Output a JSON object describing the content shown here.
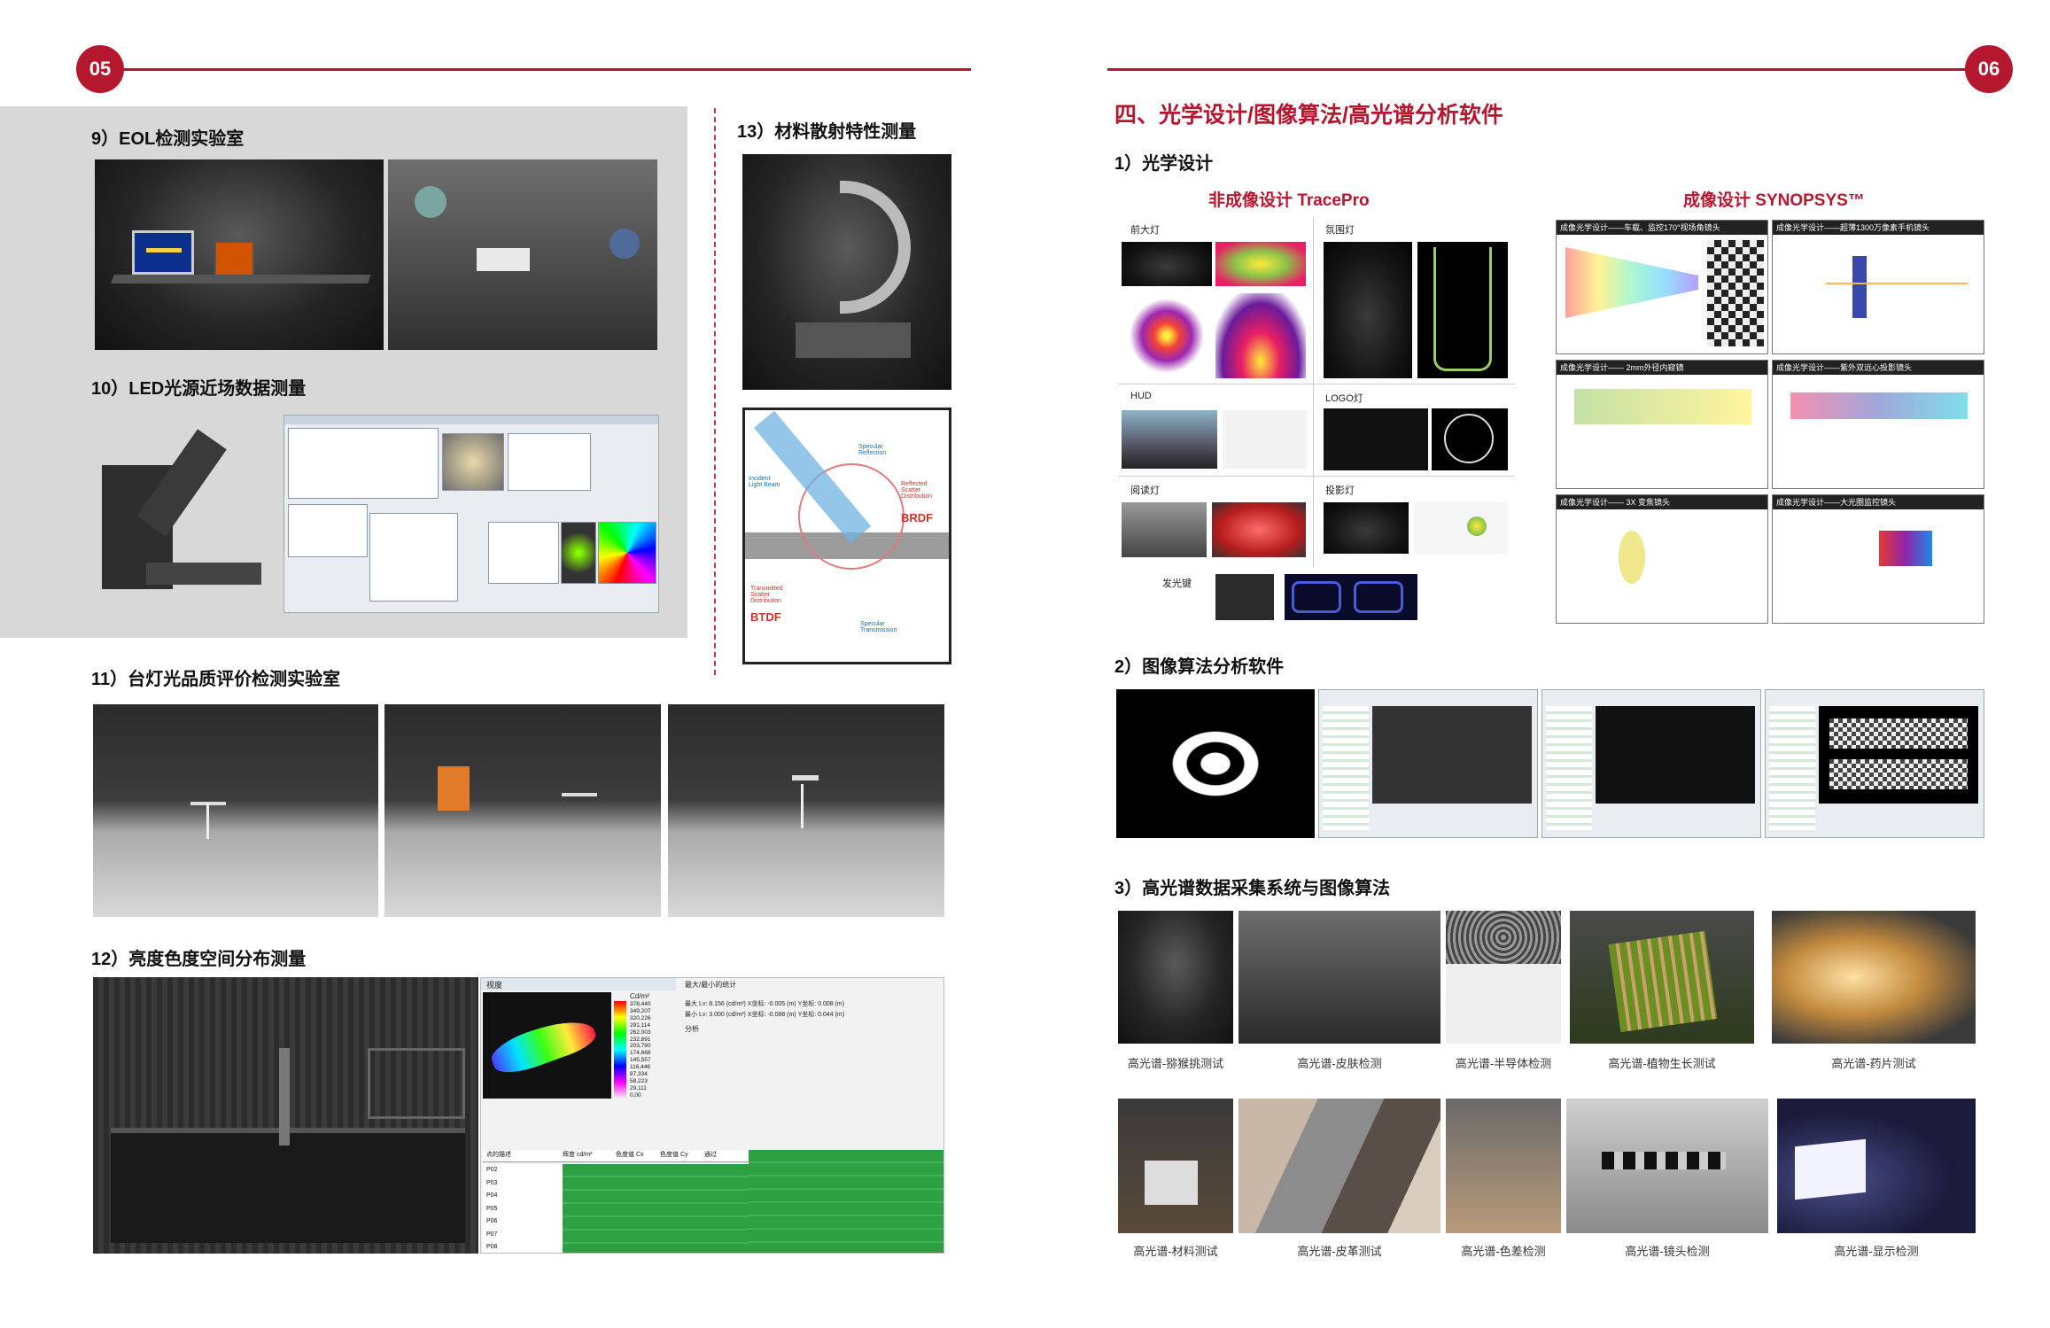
{
  "pages": {
    "left_number": "05",
    "right_number": "06"
  },
  "left": {
    "s9": {
      "title": "9）EOL检测实验室"
    },
    "s10": {
      "title": "10）LED光源近场数据测量"
    },
    "s11": {
      "title": "11）台灯光品质评价检测实验室"
    },
    "s12": {
      "title": "12）亮度色度空间分布测量",
      "ui_tab": "视度",
      "stats_title": "最大/最小的统计",
      "stats_rows": [
        "最大 Lv: 8.156 (cd/m²) X坐标: -0.005 (m)  Y坐标: 0.008 (m)",
        "最小 Lv: 3.000 (cd/m²) X坐标: -0.088 (m)  Y坐标: 0.044 (m)"
      ],
      "analysis_label": "分析",
      "legend_unit": "Cd/m²",
      "legend_values": [
        "378,440",
        "349,207",
        "320,226",
        "291,114",
        "262,003",
        "232,891",
        "203,780",
        "174,668",
        "145,557",
        "116,446",
        "87,334",
        "58,223",
        "29,111",
        "0,00"
      ],
      "table_header": [
        "点的描述",
        "辉度 cd/m²",
        "色度值 Cx",
        "色度值 Cy",
        "通过"
      ],
      "table_rows": [
        "P02",
        "P03",
        "P04",
        "P05",
        "P06",
        "P07",
        "P08"
      ]
    },
    "s13": {
      "title": "13）材料散射特性测量",
      "brdf_labels": {
        "incident": "Incident Light Beam",
        "specular_reflection": "Specular Reflection",
        "reflected_scatter": "Reflected Scatter Distribution",
        "brdf": "BRDF",
        "transmitted_scatter": "Transmitted Scatter Distribution",
        "btdf": "BTDF",
        "specular_transmission": "Specular Transmission"
      }
    }
  },
  "right": {
    "main_title": "四、光学设计/图像算法/高光谱分析软件",
    "s1": {
      "title": "1）光学设计",
      "nonimaging_title": "非成像设计 TracePro",
      "imaging_title": "成像设计 SYNOPSYS™",
      "nonimaging_items": [
        {
          "label": "前大灯"
        },
        {
          "label": "氛围灯"
        },
        {
          "label": "HUD"
        },
        {
          "label": "LOGO灯"
        },
        {
          "label": "阅读灯"
        },
        {
          "label": "投影灯"
        },
        {
          "label": "发光键"
        }
      ],
      "imaging_tiles": [
        "成像光学设计——车载、监控170°视场角镜头",
        "成像光学设计——超薄1300万像素手机镜头",
        "成像光学设计—— 2mm外径内窥镜",
        "成像光学设计——紫外双远心投影镜头",
        "成像光学设计—— 3X 变焦镜头",
        "成像光学设计——大光圈监控镜头"
      ]
    },
    "s2": {
      "title": "2）图像算法分析软件"
    },
    "s3": {
      "title": "3）高光谱数据采集系统与图像算法",
      "captions_row1": [
        "高光谱-猕猴挑测试",
        "高光谱-皮肤检测",
        "高光谱-半导体检测",
        "高光谱-植物生长测试",
        "高光谱-药片测试"
      ],
      "captions_row2": [
        "高光谱-材料测试",
        "高光谱-皮革测试",
        "高光谱-色差检测",
        "高光谱-镜头检测",
        "高光谱-显示检测"
      ]
    }
  },
  "colors": {
    "accent": "#b5172f",
    "panel_gray": "#d8d8d8",
    "table_green": "#2ea043"
  }
}
